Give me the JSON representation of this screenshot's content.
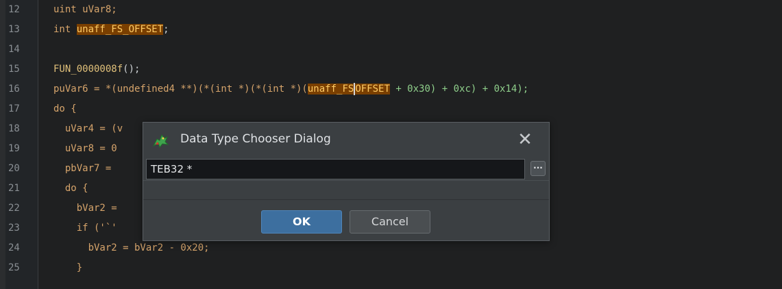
{
  "code": {
    "lines": [
      {
        "n": "12",
        "t": "uint uVar8;"
      },
      {
        "n": "13",
        "t1": "int ",
        "hl": "unaff_FS_OFFSET",
        "t2": ";"
      },
      {
        "n": "14",
        "t": ""
      },
      {
        "n": "15",
        "fn": "FUN_0000008f",
        "t": "();"
      },
      {
        "n": "16",
        "a": "puVar6 = *(undefined4 **)(*(int *)(*(int *)(",
        "hl1": "unaff_FS",
        "hl2": "OFFSET",
        "b": " + 0x30) + 0xc) + 0x14);"
      },
      {
        "n": "17",
        "t": "do {"
      },
      {
        "n": "18",
        "t": "  uVar4 = (v"
      },
      {
        "n": "19",
        "t": "  uVar8 = 0"
      },
      {
        "n": "20",
        "t": "  pbVar7 = "
      },
      {
        "n": "21",
        "t": "  do {"
      },
      {
        "n": "22",
        "t": "    bVar2 = "
      },
      {
        "n": "23",
        "t": "    if ('`'"
      },
      {
        "n": "24",
        "t": "      bVar2 = bVar2 - 0x20;"
      },
      {
        "n": "25",
        "t": "    }"
      }
    ]
  },
  "dialog": {
    "title": "Data Type Chooser Dialog",
    "input_value": "TEB32 *",
    "browse_label": "···",
    "ok_label": "OK",
    "cancel_label": "Cancel",
    "close_glyph": "✕"
  },
  "colors": {
    "background": "#1f2021",
    "highlight": "#7a3f00",
    "ok_button": "#3d6f9f"
  }
}
